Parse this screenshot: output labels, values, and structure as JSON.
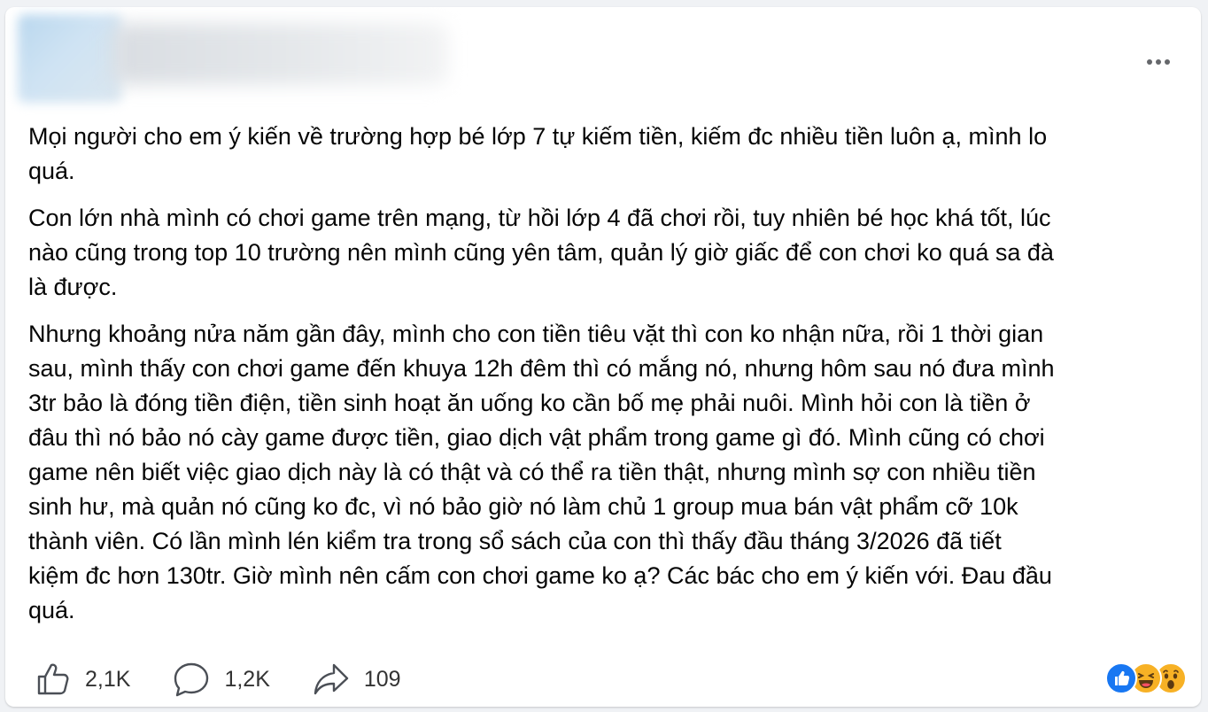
{
  "post": {
    "paragraphs": [
      "Mọi người cho em ý kiến về trường hợp bé lớp 7 tự kiếm tiền, kiếm đc nhiều tiền luôn ạ, mình lo\nquá.",
      "Con lớn nhà mình có chơi game trên mạng, từ hồi lớp 4 đã chơi rồi, tuy nhiên bé học khá tốt, lúc\nnào cũng trong top 10 trường nên mình cũng yên tâm, quản lý giờ giấc để con chơi ko quá sa đà\nlà được.",
      "Nhưng khoảng nửa năm gần đây, mình cho con tiền tiêu vặt thì con ko nhận nữa, rồi 1 thời gian\nsau, mình thấy con chơi game đến khuya 12h đêm thì có mắng nó, nhưng hôm sau nó đưa mình\n3tr bảo là đóng tiền điện, tiền sinh hoạt ăn uống ko cần bố mẹ phải nuôi. Mình hỏi con là tiền ở\nđâu thì nó bảo nó cày game được tiền, giao dịch vật phẩm trong game gì đó. Mình cũng có chơi\ngame nên biết việc giao dịch này là có thật và có thể ra tiền thật, nhưng mình sợ con nhiều tiền\nsinh hư, mà quản nó cũng ko đc, vì nó bảo giờ nó làm chủ 1 group mua bán vật phẩm cỡ 10k\nthành viên. Có lần mình lén kiểm tra trong sổ sách của con thì thấy đầu tháng 3/2026 đã tiết\nkiệm đc hơn 130tr. Giờ mình nên cấm con chơi game ko ạ? Các bác cho em ý kiến với. Đau đầu\nquá."
    ]
  },
  "actions": {
    "like_count": "2,1K",
    "comment_count": "1,2K",
    "share_count": "109"
  },
  "icons": {
    "more": "more-dots-icon",
    "like": "thumbs-up-icon",
    "comment": "comment-bubble-icon",
    "share": "share-arrow-icon",
    "reactions": [
      "like-reaction-icon",
      "haha-reaction-icon",
      "wow-reaction-icon"
    ]
  },
  "colors": {
    "like_blue": "#1877f2",
    "emoji_yellow": "#f7b125",
    "icon_gray": "#65676b"
  }
}
